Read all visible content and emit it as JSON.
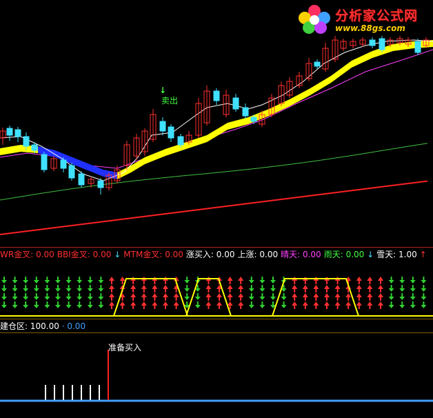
{
  "main_chart": {
    "sell_label": "卖出"
  },
  "logo": {
    "title": "分析家公式网",
    "url": "www.88gs.com"
  },
  "indicator_legend": [
    {
      "label": "WR金叉:",
      "value": "0.00",
      "label_color": "#ff3030",
      "value_color": "#ff3030",
      "arrow": ""
    },
    {
      "label": "BBI金叉:",
      "value": "0.00",
      "label_color": "#ff3030",
      "value_color": "#ff3030",
      "arrow": "↓"
    },
    {
      "label": "MTM金叉:",
      "value": "0.00",
      "label_color": "#ff3030",
      "value_color": "#ff3030",
      "arrow": ""
    },
    {
      "label": "涨买入:",
      "value": "0.00",
      "label_color": "#ffffff",
      "value_color": "#ffffff",
      "arrow": ""
    },
    {
      "label": "上涨:",
      "value": "0.00",
      "label_color": "#ffffff",
      "value_color": "#ffffff",
      "arrow": ""
    },
    {
      "label": "晴天:",
      "value": "0.00",
      "label_color": "#ff40ff",
      "value_color": "#ff40ff",
      "arrow": ""
    },
    {
      "label": "雨天:",
      "value": "0.00",
      "label_color": "#40ff40",
      "value_color": "#40ff40",
      "arrow": "↓"
    },
    {
      "label": "雪天:",
      "value": "1.00",
      "label_color": "#ffffff",
      "value_color": "#ffffff",
      "arrow": "↑"
    }
  ],
  "signal_legend": {
    "label": "建仓区:",
    "value_1": "100.00",
    "separator": "·",
    "value_2": "0.00"
  },
  "signal_pane": {
    "buy_label": "准备买入"
  },
  "colors": {
    "up": "#ff3030",
    "down": "#40e0ff",
    "band_yellow": "#ffff00",
    "band_blue": "#2030ff",
    "ma_white": "#ffffff",
    "ma_magenta": "#ff40ff",
    "ma_green": "#40c040",
    "ma_red": "#ff2020",
    "baseline_blue": "#40a0ff"
  },
  "chart_data": {
    "type": "candlestick",
    "candles_count": 40,
    "indicator_bars_count": 40,
    "indicator_up_bars": [
      10,
      11,
      12,
      13,
      14,
      15,
      16,
      19,
      20,
      21,
      22,
      27,
      28,
      29,
      30,
      31,
      32,
      33,
      34,
      35
    ]
  }
}
